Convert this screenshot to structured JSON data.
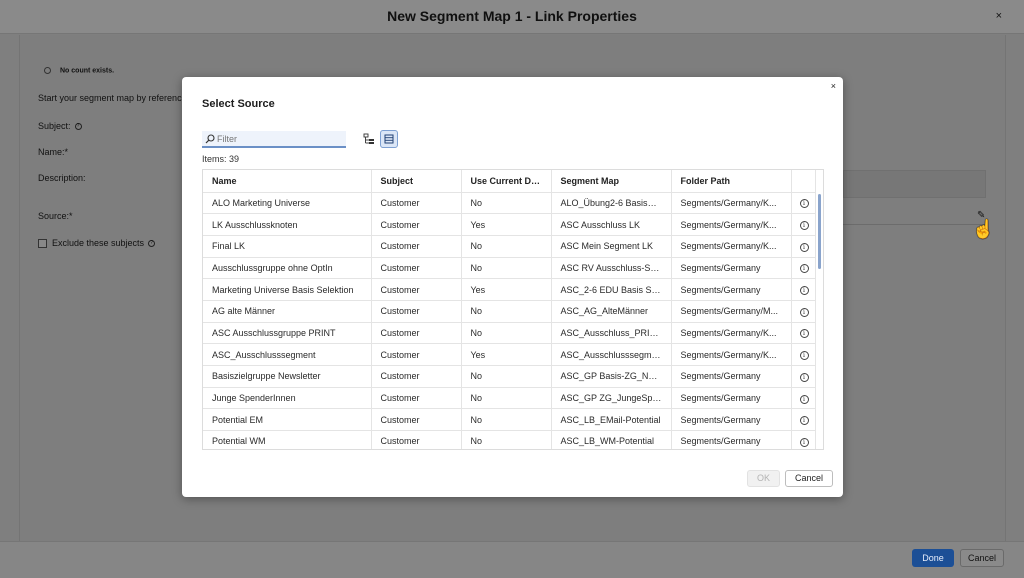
{
  "window": {
    "title": "New Segment Map 1 - Link Properties",
    "close_glyph": "×"
  },
  "background_form": {
    "no_count": "No count exists.",
    "intro": "Start your segment map by referenc",
    "subject_label": "Subject:",
    "name_label": "Name:*",
    "description_label": "Description:",
    "source_label": "Source:*",
    "exclude_label": "Exclude these subjects"
  },
  "footer": {
    "done_label": "Done",
    "cancel_label": "Cancel"
  },
  "dialog": {
    "title": "Select Source",
    "close_glyph": "×",
    "filter_placeholder": "Filter",
    "items_count": "Items: 39",
    "columns": [
      "Name",
      "Subject",
      "Use Current Data",
      "Segment Map",
      "Folder Path"
    ],
    "rows": [
      {
        "name": "ALO Marketing Universe",
        "subject": "Customer",
        "use_current": "No",
        "segment_map": "ALO_Übung2-6 BasisM...",
        "folder": "Segments/Germany/K..."
      },
      {
        "name": "LK Ausschlussknoten",
        "subject": "Customer",
        "use_current": "Yes",
        "segment_map": "ASC Ausschluss LK",
        "folder": "Segments/Germany/K..."
      },
      {
        "name": "Final LK",
        "subject": "Customer",
        "use_current": "No",
        "segment_map": "ASC Mein Segment LK",
        "folder": "Segments/Germany/K..."
      },
      {
        "name": "Ausschlussgruppe ohne OptIn",
        "subject": "Customer",
        "use_current": "No",
        "segment_map": "ASC RV Ausschluss-Se...",
        "folder": "Segments/Germany"
      },
      {
        "name": "Marketing Universe Basis Selektion",
        "subject": "Customer",
        "use_current": "Yes",
        "segment_map": "ASC_2-6 EDU Basis Sel...",
        "folder": "Segments/Germany"
      },
      {
        "name": "AG alte Männer",
        "subject": "Customer",
        "use_current": "No",
        "segment_map": "ASC_AG_AlteMänner",
        "folder": "Segments/Germany/M..."
      },
      {
        "name": "ASC Ausschlussgruppe PRINT",
        "subject": "Customer",
        "use_current": "No",
        "segment_map": "ASC_Ausschluss_PRINT",
        "folder": "Segments/Germany/K..."
      },
      {
        "name": "ASC_Ausschlusssegment",
        "subject": "Customer",
        "use_current": "Yes",
        "segment_map": "ASC_Ausschlusssegme...",
        "folder": "Segments/Germany/K..."
      },
      {
        "name": "Basiszielgruppe Newsletter",
        "subject": "Customer",
        "use_current": "No",
        "segment_map": "ASC_GP Basis-ZG_New...",
        "folder": "Segments/Germany"
      },
      {
        "name": "Junge SpenderInnen",
        "subject": "Customer",
        "use_current": "No",
        "segment_map": "ASC_GP ZG_JungeSpe...",
        "folder": "Segments/Germany"
      },
      {
        "name": "Potential EM",
        "subject": "Customer",
        "use_current": "No",
        "segment_map": "ASC_LB_EMail-Potential",
        "folder": "Segments/Germany"
      },
      {
        "name": "Potential WM",
        "subject": "Customer",
        "use_current": "No",
        "segment_map": "ASC_LB_WM-Potential",
        "folder": "Segments/Germany"
      }
    ],
    "ok_label": "OK",
    "cancel_label": "Cancel"
  },
  "icons": {
    "search": "search-icon",
    "tree_view": "tree-view-icon",
    "list_view": "list-view-icon",
    "info": "info-icon",
    "edit": "pencil-icon",
    "cursor": "hand-cursor-icon"
  },
  "colors": {
    "primary": "#1c4f96",
    "filter_underline": "#6b90c6",
    "overlay": "#7f7f7f"
  }
}
